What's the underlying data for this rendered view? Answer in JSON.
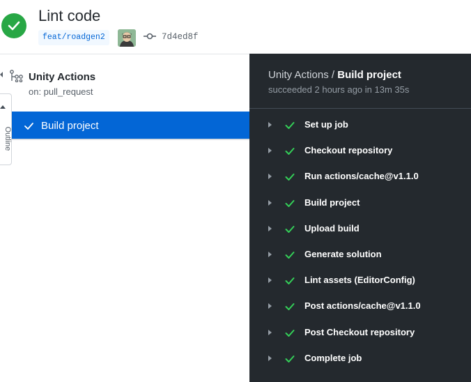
{
  "header": {
    "title": "Lint code",
    "branch": "feat/roadgen2",
    "commit_sha": "7d4ed8f",
    "status": "success"
  },
  "workflow": {
    "name": "Unity Actions",
    "trigger": "on: pull_request"
  },
  "outline_tab": {
    "label": "Outline"
  },
  "jobs": [
    {
      "label": "Build project",
      "selected": true,
      "status": "success"
    }
  ],
  "log": {
    "breadcrumb_workflow": "Unity Actions",
    "breadcrumb_sep": " / ",
    "breadcrumb_job": "Build project",
    "status_text": "succeeded 2 hours ago in 13m 35s",
    "steps": [
      {
        "label": "Set up job",
        "status": "success"
      },
      {
        "label": "Checkout repository",
        "status": "success"
      },
      {
        "label": "Run actions/cache@v1.1.0",
        "status": "success"
      },
      {
        "label": "Build project",
        "status": "success"
      },
      {
        "label": "Upload build",
        "status": "success"
      },
      {
        "label": "Generate solution",
        "status": "success"
      },
      {
        "label": "Lint assets (EditorConfig)",
        "status": "success"
      },
      {
        "label": "Post actions/cache@v1.1.0",
        "status": "success"
      },
      {
        "label": "Post Checkout repository",
        "status": "success"
      },
      {
        "label": "Complete job",
        "status": "success"
      }
    ]
  },
  "colors": {
    "success": "#28a745",
    "success_dark": "#34d058",
    "selected": "#0366d6",
    "log_bg": "#24292e"
  },
  "icons": {
    "status": "check-circle-icon",
    "commit": "git-commit-icon",
    "workflow": "workflow-icon",
    "step_expand": "triangle-right-icon",
    "step_status": "check-icon"
  }
}
